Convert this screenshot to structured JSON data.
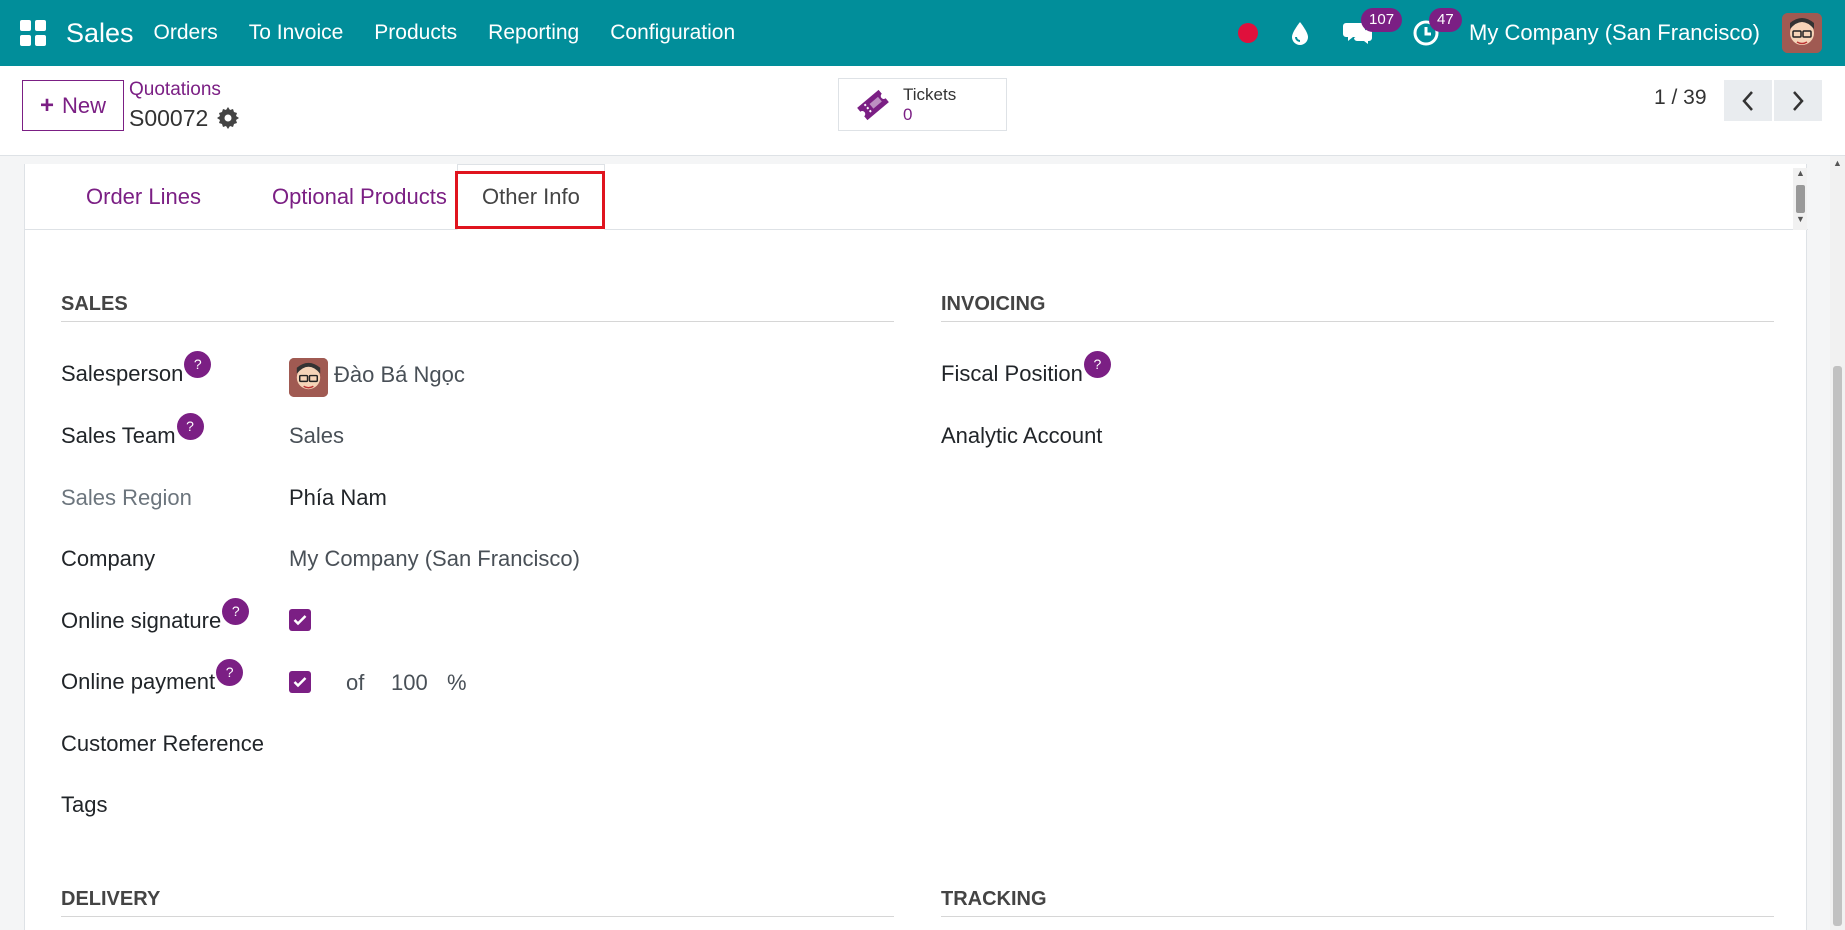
{
  "navbar": {
    "app_name": "Sales",
    "menu": [
      "Orders",
      "To Invoice",
      "Products",
      "Reporting",
      "Configuration"
    ],
    "messages_count": "107",
    "activities_count": "47",
    "company": "My Company (San Francisco)",
    "accent_color": "#018e9a"
  },
  "control_panel": {
    "new_label": "New",
    "breadcrumb": "Quotations",
    "record_name": "S00072",
    "smart_button": {
      "label": "Tickets",
      "value": "0"
    },
    "pager": "1 / 39"
  },
  "tabs": [
    "Order Lines",
    "Optional Products",
    "Other Info"
  ],
  "active_tab": "Other Info",
  "sales_group": {
    "title": "SALES",
    "salesperson_label": "Salesperson",
    "salesperson_value": "Đào Bá Ngọc",
    "sales_team_label": "Sales Team",
    "sales_team_value": "Sales",
    "sales_region_label": "Sales Region",
    "sales_region_value": "Phía Nam",
    "company_label": "Company",
    "company_value": "My Company (San Francisco)",
    "online_signature_label": "Online signature",
    "online_signature_checked": true,
    "online_payment_label": "Online payment",
    "online_payment_checked": true,
    "online_payment_of": "of",
    "online_payment_percent_value": "100",
    "online_payment_percent_sign": "%",
    "customer_reference_label": "Customer Reference",
    "tags_label": "Tags"
  },
  "invoicing_group": {
    "title": "INVOICING",
    "fiscal_position_label": "Fiscal Position",
    "analytic_account_label": "Analytic Account"
  },
  "delivery_group": {
    "title": "DELIVERY"
  },
  "tracking_group": {
    "title": "TRACKING"
  },
  "help_glyph": "?",
  "brand_color": "#7b1f84"
}
